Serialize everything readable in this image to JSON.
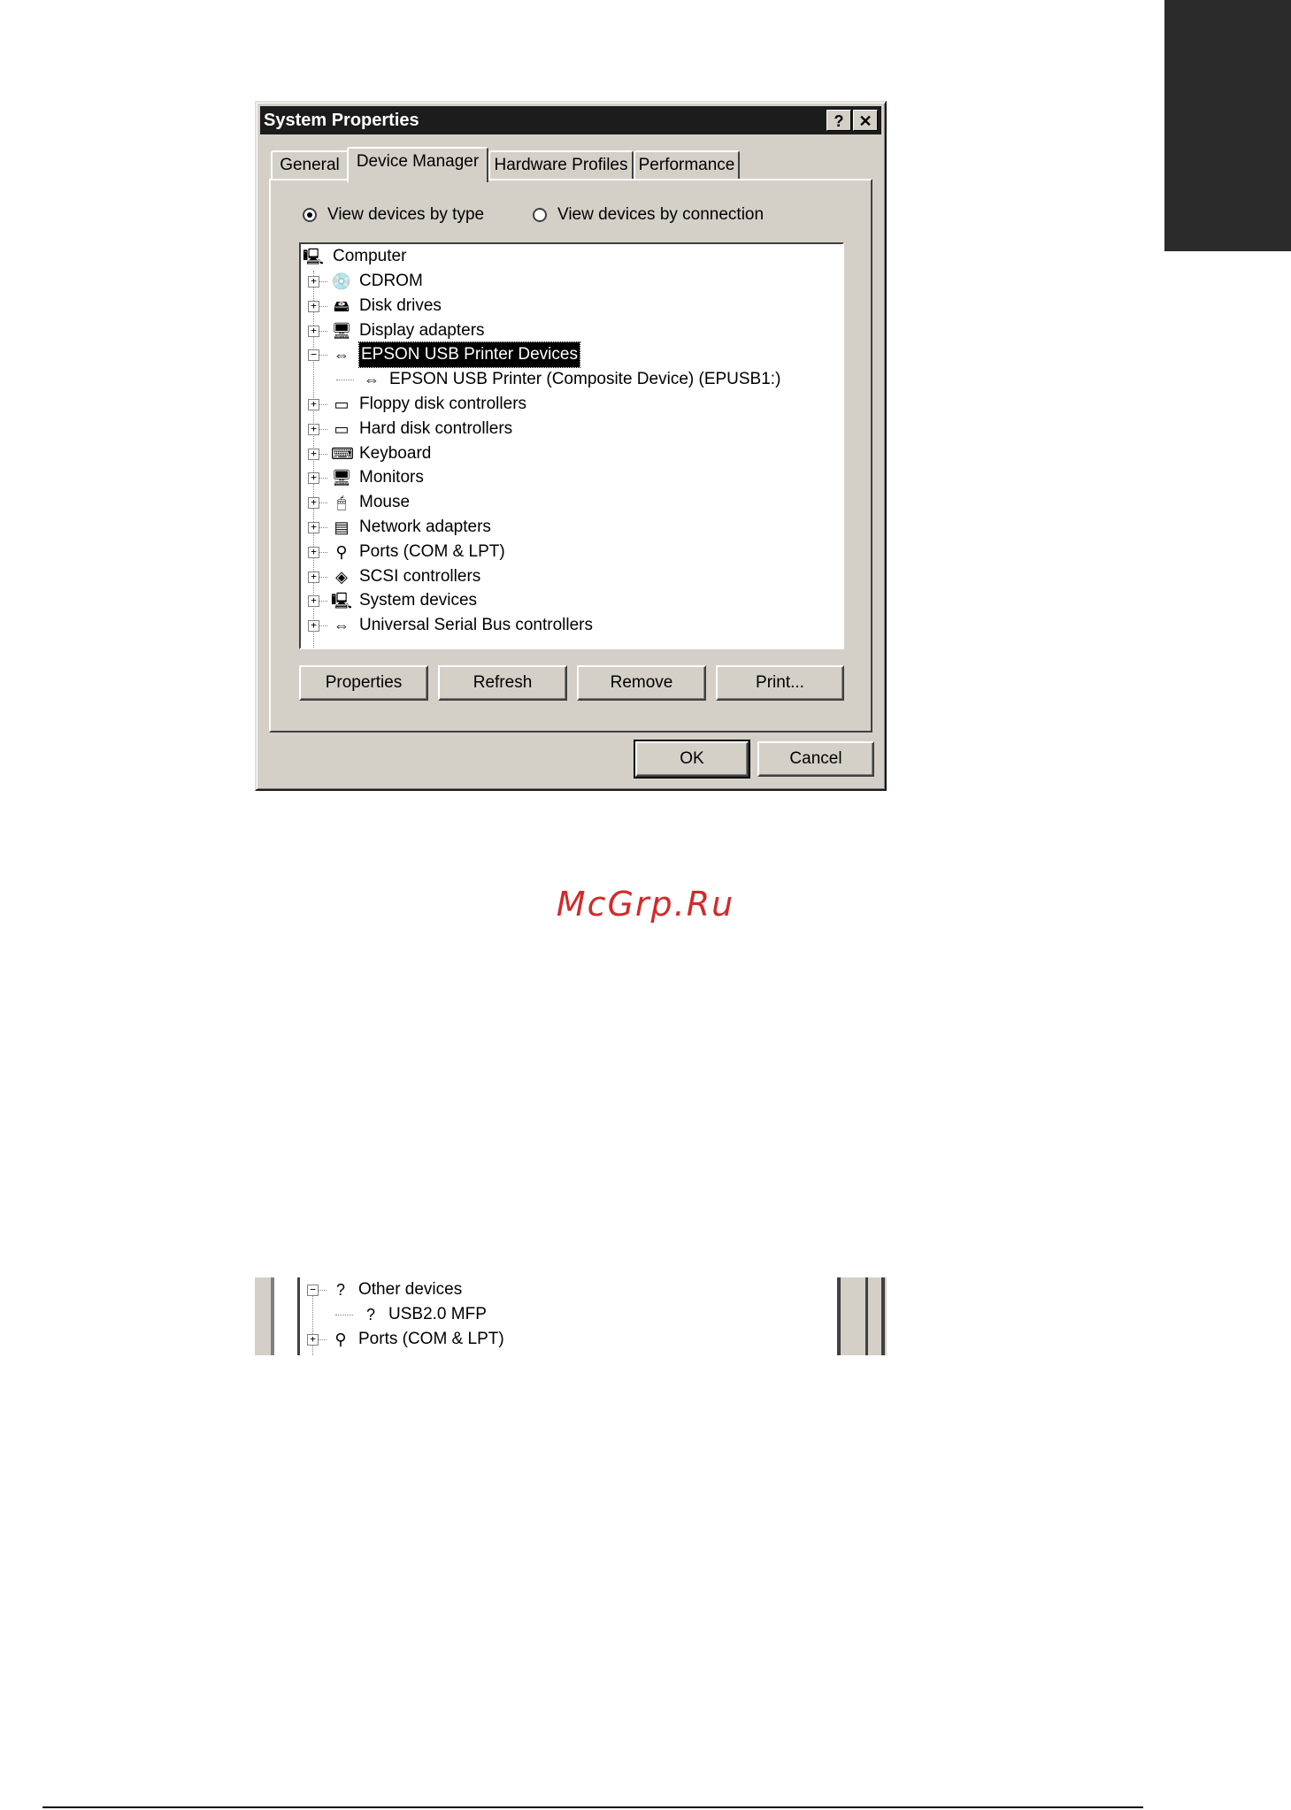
{
  "window": {
    "title": "System Properties",
    "help_button": "?",
    "close_button": "✕"
  },
  "tabs": [
    {
      "label": "General"
    },
    {
      "label": "Device Manager"
    },
    {
      "label": "Hardware Profiles"
    },
    {
      "label": "Performance"
    }
  ],
  "view_options": {
    "by_type": "View devices by type",
    "by_connection": "View devices by connection",
    "selected": "by_type"
  },
  "tree": {
    "root": "Computer",
    "items": [
      {
        "label": "CDROM",
        "icon": "cdrom-icon",
        "glyph": "💿",
        "expander": "+"
      },
      {
        "label": "Disk drives",
        "icon": "disk-drive-icon",
        "glyph": "🖴",
        "expander": "+"
      },
      {
        "label": "Display adapters",
        "icon": "display-adapter-icon",
        "glyph": "🖥",
        "expander": "+"
      },
      {
        "label": "EPSON USB Printer Devices",
        "icon": "usb-icon",
        "glyph": "⇔",
        "expander": "−",
        "selected": true
      },
      {
        "label": "EPSON USB Printer (Composite Device) (EPUSB1:)",
        "icon": "usb-icon",
        "glyph": "⇔",
        "child": true
      },
      {
        "label": "Floppy disk controllers",
        "icon": "floppy-controller-icon",
        "glyph": "▭",
        "expander": "+"
      },
      {
        "label": "Hard disk controllers",
        "icon": "hard-disk-controller-icon",
        "glyph": "▭",
        "expander": "+"
      },
      {
        "label": "Keyboard",
        "icon": "keyboard-icon",
        "glyph": "⌨",
        "expander": "+"
      },
      {
        "label": "Monitors",
        "icon": "monitor-icon",
        "glyph": "🖥",
        "expander": "+"
      },
      {
        "label": "Mouse",
        "icon": "mouse-icon",
        "glyph": "🖱",
        "expander": "+"
      },
      {
        "label": "Network adapters",
        "icon": "network-adapter-icon",
        "glyph": "▤",
        "expander": "+"
      },
      {
        "label": "Ports (COM & LPT)",
        "icon": "port-icon",
        "glyph": "⚲",
        "expander": "+"
      },
      {
        "label": "SCSI controllers",
        "icon": "scsi-icon",
        "glyph": "◈",
        "expander": "+"
      },
      {
        "label": "System devices",
        "icon": "system-device-icon",
        "glyph": "🖳",
        "expander": "+"
      },
      {
        "label": "Universal Serial Bus controllers",
        "icon": "usb-icon",
        "glyph": "⇔",
        "expander": "+"
      }
    ]
  },
  "buttons": {
    "properties": "Properties",
    "refresh": "Refresh",
    "remove": "Remove",
    "print": "Print...",
    "ok": "OK",
    "cancel": "Cancel"
  },
  "watermark": "McGrp.Ru",
  "snippet": {
    "items": [
      {
        "label": "Other devices",
        "icon": "unknown-device-icon",
        "glyph": "?",
        "expander": "−"
      },
      {
        "label": "USB2.0 MFP",
        "icon": "unknown-device-icon",
        "glyph": "?",
        "child": true
      },
      {
        "label": "Ports (COM & LPT)",
        "icon": "port-icon",
        "glyph": "⚲",
        "expander": "+"
      }
    ]
  }
}
